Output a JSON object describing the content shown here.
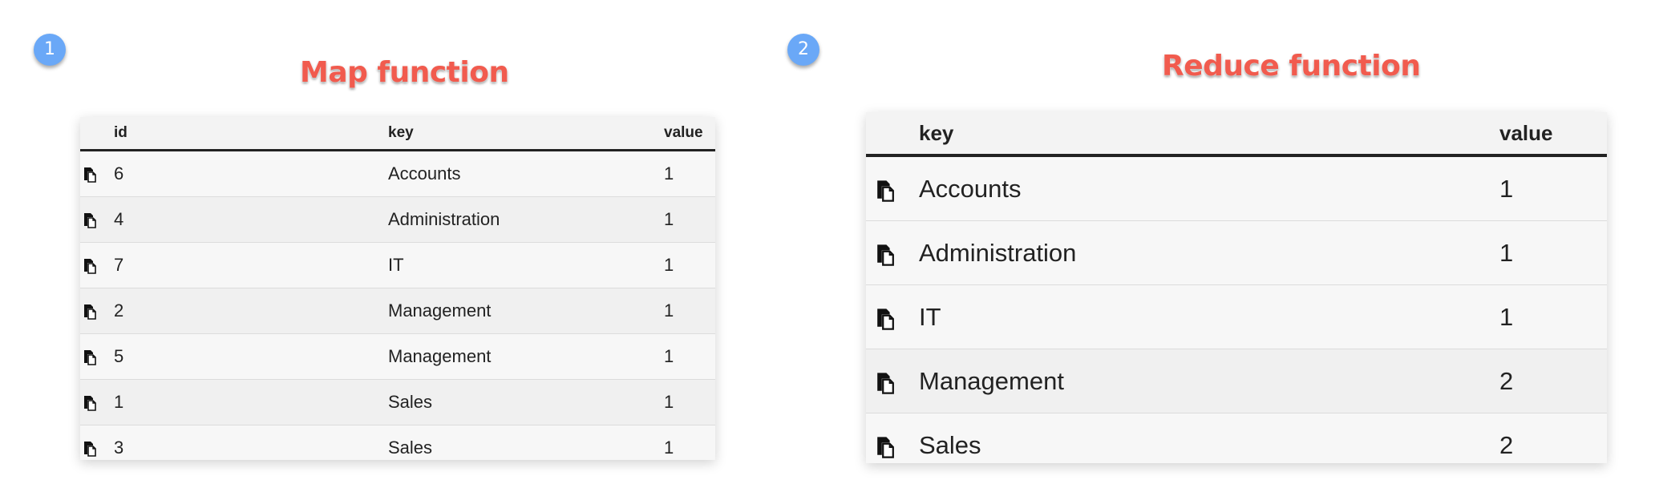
{
  "badges": [
    "1",
    "2"
  ],
  "map": {
    "title": "Map function",
    "headers": {
      "id": "id",
      "key": "key",
      "value": "value"
    },
    "rows": [
      {
        "id": "6",
        "key": "Accounts",
        "value": "1"
      },
      {
        "id": "4",
        "key": "Administration",
        "value": "1"
      },
      {
        "id": "7",
        "key": "IT",
        "value": "1"
      },
      {
        "id": "2",
        "key": "Management",
        "value": "1"
      },
      {
        "id": "5",
        "key": "Management",
        "value": "1"
      },
      {
        "id": "1",
        "key": "Sales",
        "value": "1"
      },
      {
        "id": "3",
        "key": "Sales",
        "value": "1"
      }
    ]
  },
  "reduce": {
    "title": "Reduce function",
    "headers": {
      "key": "key",
      "value": "value"
    },
    "rows": [
      {
        "key": "Accounts",
        "value": "1"
      },
      {
        "key": "Administration",
        "value": "1"
      },
      {
        "key": "IT",
        "value": "1"
      },
      {
        "key": "Management",
        "value": "2"
      },
      {
        "key": "Sales",
        "value": "2"
      }
    ]
  },
  "icons": {
    "row_icon": "document-copy-icon"
  },
  "colors": {
    "badge": "#6aa8f7",
    "callout": "#f15b4e",
    "header_rule": "#222222"
  }
}
